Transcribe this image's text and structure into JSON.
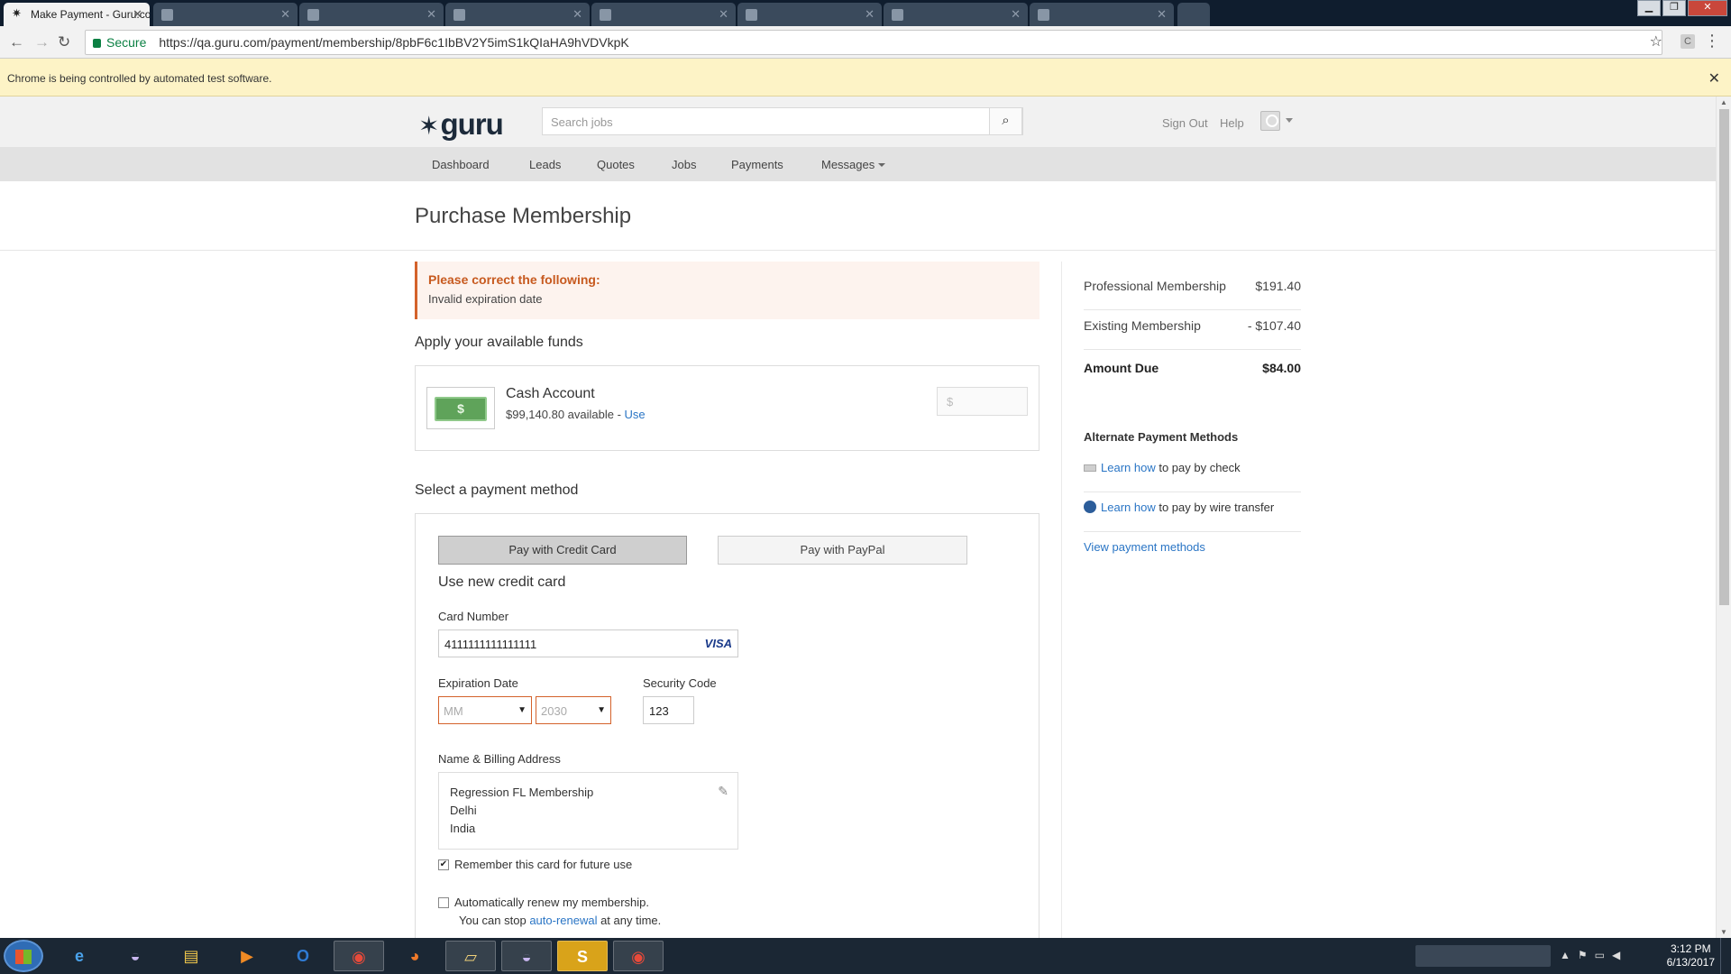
{
  "browser": {
    "tabs": [
      {
        "title": "Make Payment - Guru.co",
        "active": true
      },
      {
        "title": "",
        "active": false
      },
      {
        "title": "",
        "active": false
      },
      {
        "title": "",
        "active": false
      },
      {
        "title": "",
        "active": false
      },
      {
        "title": "",
        "active": false
      },
      {
        "title": "",
        "active": false
      },
      {
        "title": "",
        "active": false
      }
    ],
    "secure_label": "Secure",
    "url": "https://qa.guru.com/payment/membership/8pbF6c1IbBV2Y5imS1kQIaHA9hVDVkpK",
    "automation_notice": "Chrome is being controlled by automated test software."
  },
  "header": {
    "logo_text": "guru",
    "search_placeholder": "Search jobs",
    "sign_out": "Sign Out",
    "help": "Help"
  },
  "nav": {
    "items": [
      "Dashboard",
      "Leads",
      "Quotes",
      "Jobs",
      "Payments",
      "Messages"
    ]
  },
  "page_title": "Purchase Membership",
  "alert": {
    "heading": "Please correct the following:",
    "message": "Invalid expiration date"
  },
  "funds": {
    "heading": "Apply your available funds",
    "account_name": "Cash Account",
    "available": "$99,140.80 available - ",
    "use_link": "Use",
    "amount_placeholder": "$"
  },
  "payment": {
    "heading": "Select a payment method",
    "credit_card_button": "Pay with Credit Card",
    "paypal_button": "Pay with PayPal",
    "new_card_title": "Use new credit card",
    "card_number_label": "Card Number",
    "card_number": "4111111111111111",
    "card_brand": "VISA",
    "expiration_label": "Expiration Date",
    "exp_month": "MM",
    "exp_year": "2030",
    "security_label": "Security Code",
    "security_code": "123",
    "billing_label": "Name & Billing Address",
    "billing_lines": [
      "Regression FL Membership",
      "Delhi",
      "India"
    ],
    "remember_label": "Remember this card for future use",
    "remember_checked": true,
    "autorenew_label": "Automatically renew my membership.",
    "autorenew_note_pre": "You can stop ",
    "autorenew_link": "auto-renewal",
    "autorenew_note_post": " at any time.",
    "autorenew_checked": false
  },
  "summary": {
    "rows": [
      {
        "label": "Professional Membership",
        "value": "$191.40"
      },
      {
        "label": "Existing Membership",
        "value": "- $107.40"
      }
    ],
    "total_label": "Amount Due",
    "total_value": "$84.00"
  },
  "alternate": {
    "heading": "Alternate Payment Methods",
    "check_link": "Learn how",
    "check_text": " to pay by check",
    "wire_link": "Learn how",
    "wire_text": " to pay by wire transfer",
    "view_link": "View payment methods"
  },
  "taskbar": {
    "time": "3:12 PM",
    "date": "6/13/2017"
  },
  "colors": {
    "alert_accent": "#d4622b",
    "link": "#2a75c5",
    "secure_green": "#0b8043",
    "infobar": "#fdf3c6"
  }
}
